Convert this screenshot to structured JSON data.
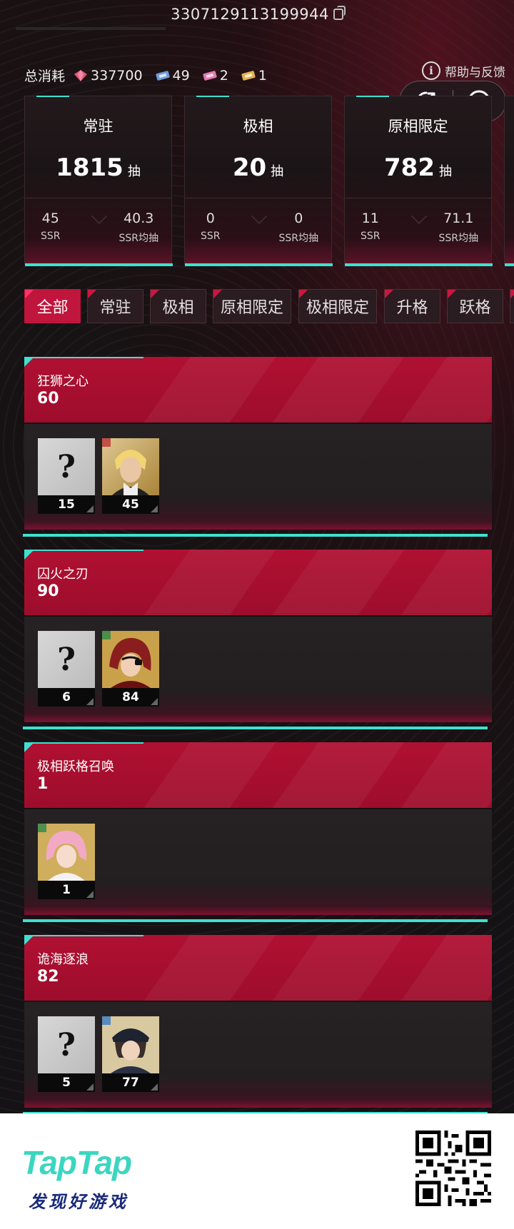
{
  "header": {
    "uid": "3307129113199944"
  },
  "consumption": {
    "label": "总消耗",
    "items": [
      {
        "icon": "pink-crystal-icon",
        "value": "337700",
        "color": "#e0577a"
      },
      {
        "icon": "blue-ticket-icon",
        "value": "49",
        "color": "#6f9bd8"
      },
      {
        "icon": "pink-ticket-icon",
        "value": "2",
        "color": "#e07ab0"
      },
      {
        "icon": "gold-ticket-icon",
        "value": "1",
        "color": "#e0b050"
      }
    ]
  },
  "help": {
    "label": "帮助与反馈"
  },
  "stats": [
    {
      "title": "常驻",
      "pulls": "1815",
      "unit": "抽",
      "ssr": "45",
      "ssr_label": "SSR",
      "avg": "40.3",
      "avg_label": "SSR均抽"
    },
    {
      "title": "极相",
      "pulls": "20",
      "unit": "抽",
      "ssr": "0",
      "ssr_label": "SSR",
      "avg": "0",
      "avg_label": "SSR均抽"
    },
    {
      "title": "原相限定",
      "pulls": "782",
      "unit": "抽",
      "ssr": "11",
      "ssr_label": "SSR",
      "avg": "71.1",
      "avg_label": "SSR均抽"
    }
  ],
  "tabs": [
    {
      "label": "全部",
      "active": true
    },
    {
      "label": "常驻"
    },
    {
      "label": "极相"
    },
    {
      "label": "原相限定"
    },
    {
      "label": "极相限定"
    },
    {
      "label": "升格"
    },
    {
      "label": "跃格"
    }
  ],
  "banners": [
    {
      "name": "狂狮之心",
      "count": "60",
      "tiles": [
        {
          "kind": "unknown",
          "value": "15"
        },
        {
          "kind": "character",
          "value": "45"
        }
      ]
    },
    {
      "name": "囚火之刃",
      "count": "90",
      "tiles": [
        {
          "kind": "unknown",
          "value": "6"
        },
        {
          "kind": "character",
          "value": "84"
        }
      ]
    },
    {
      "name": "极相跃格召唤",
      "count": "1",
      "tiles": [
        {
          "kind": "character",
          "value": "1"
        }
      ]
    },
    {
      "name": "诡海逐浪",
      "count": "82",
      "tiles": [
        {
          "kind": "unknown",
          "value": "5"
        },
        {
          "kind": "character",
          "value": "77"
        }
      ]
    }
  ],
  "unknown_glyph": "?",
  "footer": {
    "brand": "TapTap",
    "slogan": "发现好游戏",
    "brand_color": "#3bd6c0"
  },
  "colors": {
    "accent": "#c0153c",
    "cyan": "#3fe0cf"
  }
}
